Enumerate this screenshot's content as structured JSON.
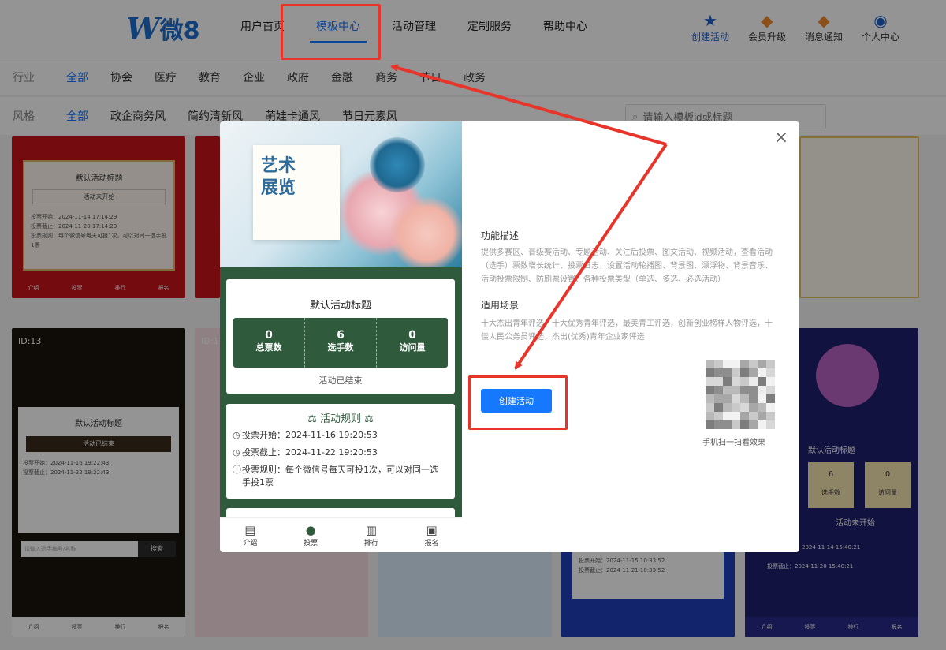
{
  "colors": {
    "accent": "#1677ff",
    "brand": "#1e6fd0",
    "preview_green": "#2f5a3c",
    "highlight_red": "#e8352c"
  },
  "header": {
    "logo_letter": "W",
    "logo_text": "微8",
    "nav": [
      {
        "label": "用户首页"
      },
      {
        "label": "模板中心"
      },
      {
        "label": "活动管理"
      },
      {
        "label": "定制服务"
      },
      {
        "label": "帮助中心"
      }
    ],
    "nav_active": "模板中心",
    "actions": [
      {
        "label": "创建活动",
        "icon": "star-icon"
      },
      {
        "label": "会员升级",
        "icon": "badge-icon"
      },
      {
        "label": "消息通知",
        "icon": "badge-icon"
      },
      {
        "label": "个人中心",
        "icon": "user-icon"
      }
    ]
  },
  "filters": {
    "industry_label": "行业",
    "industry": [
      "全部",
      "协会",
      "医疗",
      "教育",
      "企业",
      "政府",
      "金融",
      "商务",
      "节日",
      "政务"
    ],
    "style_label": "风格",
    "style": [
      "全部",
      "政企商务风",
      "简约清新风",
      "萌娃卡通风",
      "节日元素风"
    ],
    "search_placeholder": "请输入模板id或标题"
  },
  "background_cards": {
    "card1_title": "默认活动标题",
    "card1_status": "活动未开始",
    "card1_start": "投票开始：2024-11-14 17:14:29",
    "card1_end": "投票截止：2024-11-20 17:14:29",
    "card1_rule": "投票规则：每个微信号每天可投1次，可以对同一选手投1票",
    "card2_id": "ID:13",
    "card2_title": "默认活动标题",
    "card2_status": "活动已结束",
    "card2_start": "投票开始：2024-11-16 19:22:43",
    "card2_end": "投票截止：2024-11-22 19:22:43",
    "card2_search": "请输入选手编号/名称",
    "card2_search_btn": "搜索",
    "card3_id": "ID:17",
    "card6_title": "默认活动标题",
    "card6_status": "活动未开始",
    "card6_start": "2024-11-14 15:40:21",
    "card6_end": "投票截止：2024-11-20 15:40:21",
    "card6_stat": "6",
    "card6_stat2": "0",
    "card6_l1": "选手数",
    "card6_l2": "访问量",
    "card5_start": "投票开始：2024-11-15 10:33:52",
    "card5_end": "投票截止：2024-11-21 10:33:52",
    "tabs": [
      "介绍",
      "投票",
      "排行",
      "报名"
    ]
  },
  "modal": {
    "preview": {
      "banner_title_1": "艺术",
      "banner_title_2": "展览",
      "title": "默认活动标题",
      "stats": [
        {
          "value": "0",
          "label": "总票数"
        },
        {
          "value": "6",
          "label": "选手数"
        },
        {
          "value": "0",
          "label": "访问量"
        }
      ],
      "status": "活动已结束",
      "rules_title": "活动规则",
      "rule_start": "投票开始：2024-11-16 19:20:53",
      "rule_end": "投票截止：2024-11-22 19:20:53",
      "rule_text": "投票规则：每个微信号每天可投1次，可以对同一选手投1票",
      "tabs": [
        {
          "label": "介绍",
          "icon": "document-icon"
        },
        {
          "label": "投票",
          "icon": "person-icon"
        },
        {
          "label": "排行",
          "icon": "bar-chart-icon"
        },
        {
          "label": "报名",
          "icon": "signup-icon"
        }
      ],
      "active_tab": "投票"
    },
    "feature_title": "功能描述",
    "feature_text": "提供多赛区、晋级赛活动、专题活动、关注后投票、图文活动、视频活动，查看活动（选手）票数增长统计、投票日志，设置活动轮播图、背景图、漂浮物、背景音乐、活动投票限制、防刷票设置、各种投票类型（单选、多选、必选活动）",
    "scene_title": "适用场景",
    "scene_text": "十大杰出青年评选、十大优秀青年评选，最美青工评选，创新创业榜样人物评选，十佳人民公务员评选，杰出(优秀)青年企业家评选",
    "create_button": "创建活动",
    "qr_caption": "手机扫一扫看效果"
  }
}
